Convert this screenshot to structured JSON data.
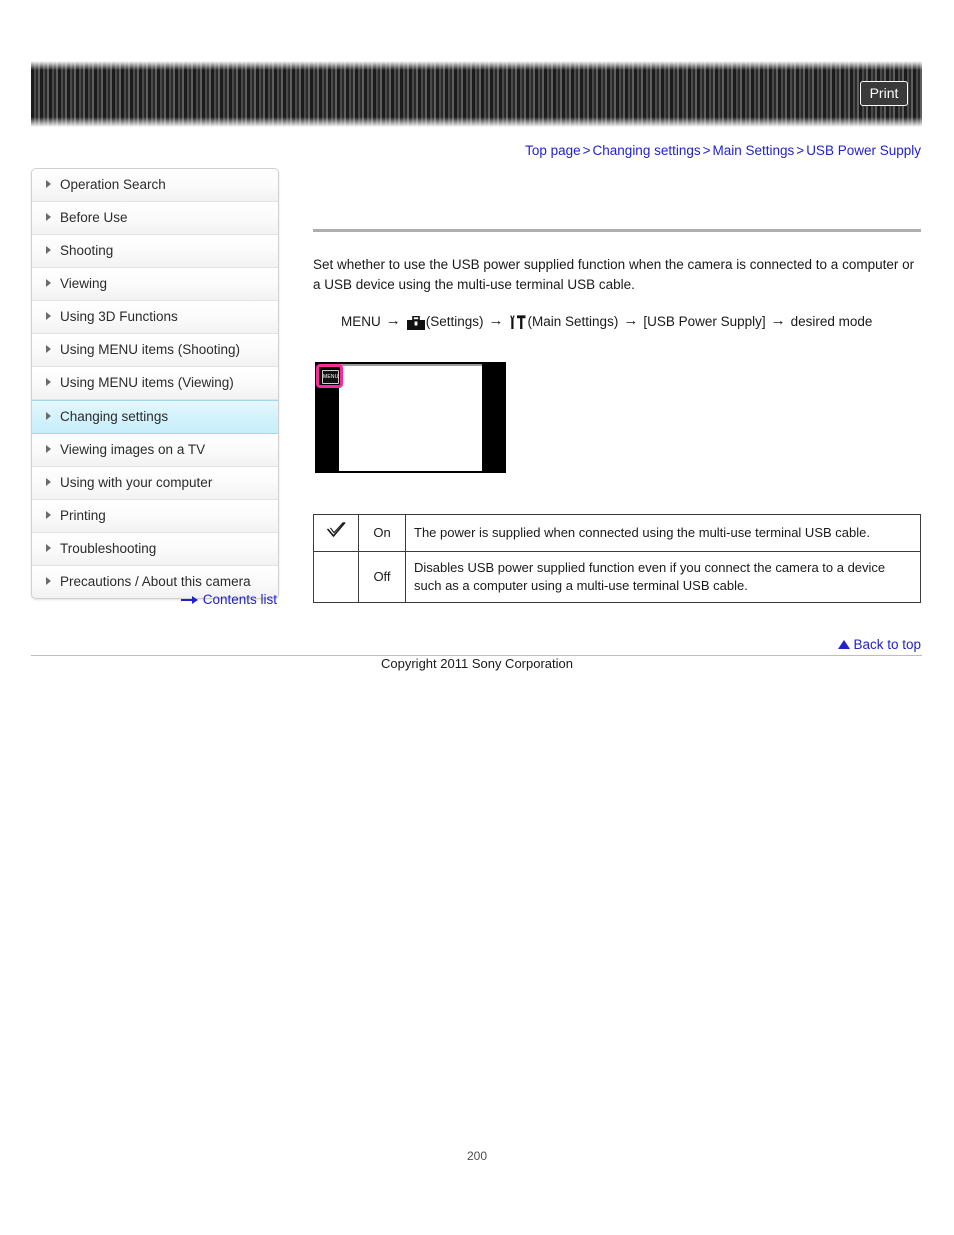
{
  "header": {
    "print_label": "Print"
  },
  "breadcrumb": {
    "separator": ">",
    "items": [
      {
        "label": "Top page"
      },
      {
        "label": "Changing settings"
      },
      {
        "label": "Main Settings"
      },
      {
        "label": "USB Power Supply"
      }
    ]
  },
  "sidebar": {
    "items": [
      {
        "label": "Operation Search",
        "active": false
      },
      {
        "label": "Before Use",
        "active": false
      },
      {
        "label": "Shooting",
        "active": false
      },
      {
        "label": "Viewing",
        "active": false
      },
      {
        "label": "Using 3D Functions",
        "active": false
      },
      {
        "label": "Using MENU items (Shooting)",
        "active": false
      },
      {
        "label": "Using MENU items (Viewing)",
        "active": false
      },
      {
        "label": "Changing settings",
        "active": true
      },
      {
        "label": "Viewing images on a TV",
        "active": false
      },
      {
        "label": "Using with your computer",
        "active": false
      },
      {
        "label": "Printing",
        "active": false
      },
      {
        "label": "Troubleshooting",
        "active": false
      },
      {
        "label": "Precautions / About this camera",
        "active": false
      }
    ],
    "contents_list_label": "Contents list"
  },
  "main": {
    "description": "Set whether to use the USB power supplied function when the camera is connected to a computer or a USB device using the multi-use terminal USB cable.",
    "menu_path": {
      "start": "MENU",
      "arrow": "→",
      "settings_label": "(Settings)",
      "main_settings_label": "(Main Settings)",
      "item_label": "[USB Power Supply]",
      "end_label": "desired mode"
    },
    "figure": {
      "menu_button_label": "MENU",
      "highlight_color": "#f62d98"
    },
    "options_table": {
      "rows": [
        {
          "checked": true,
          "check_glyph": "✓",
          "mode": "On",
          "description": "The power is supplied when connected using the multi-use terminal USB cable."
        },
        {
          "checked": false,
          "check_glyph": "",
          "mode": "Off",
          "description": "Disables USB power supplied function even if you connect the camera to a device such as a computer using a multi-use terminal USB cable."
        }
      ]
    }
  },
  "footer": {
    "back_to_top_label": "Back to top",
    "copyright": "Copyright 2011 Sony Corporation",
    "page_number": "200"
  }
}
